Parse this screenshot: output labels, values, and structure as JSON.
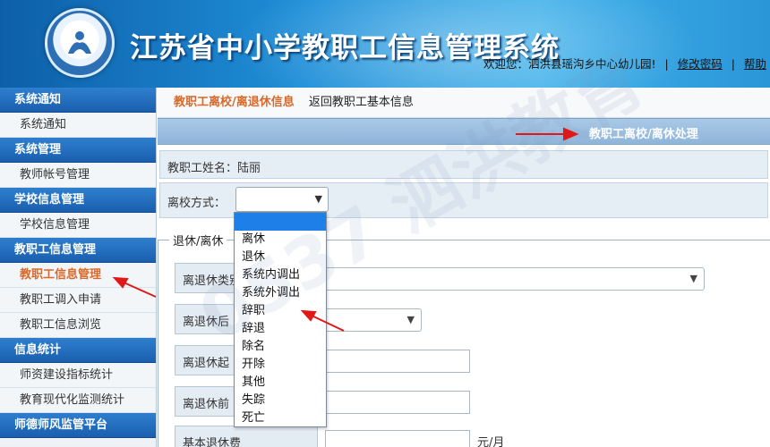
{
  "header": {
    "title": "江苏省中小学教职工信息管理系统",
    "welcome": "欢迎您：泗洪县瑶沟乡中心幼儿园!",
    "change_password": "修改密码",
    "help": "帮助"
  },
  "sidebar": {
    "sections": [
      {
        "title": "系统通知",
        "items": [
          "系统通知"
        ]
      },
      {
        "title": "系统管理",
        "items": [
          "教师帐号管理"
        ]
      },
      {
        "title": "学校信息管理",
        "items": [
          "学校信息管理"
        ]
      },
      {
        "title": "教职工信息管理",
        "items": [
          "教职工信息管理",
          "教职工调入申请",
          "教职工信息浏览"
        ]
      },
      {
        "title": "信息统计",
        "items": [
          "师资建设指标统计",
          "教育现代化监测统计"
        ]
      },
      {
        "title": "师德师风监管平台",
        "items": []
      }
    ],
    "active_item": "教职工信息管理"
  },
  "breadcrumb": {
    "current": "教职工离校/离退休信息",
    "back": "返回教职工基本信息"
  },
  "panel_title": "教职工离校/离休处理",
  "form": {
    "name_label": "教职工姓名：陆丽",
    "leave_mode_label": "离校方式：",
    "leave_mode_value": "",
    "leave_mode_options": [
      "",
      "离休",
      "退休",
      "系统内调出",
      "系统外调出",
      "辞职",
      "辞退",
      "除名",
      "开除",
      "其他",
      "失踪",
      "死亡"
    ],
    "section_legend": "退休/离休",
    "fields": [
      {
        "label": "离退休类别",
        "value": ""
      },
      {
        "label": "离退休后",
        "value": ""
      },
      {
        "label": "离退休起",
        "value": ""
      },
      {
        "label": "离退休前",
        "value": ""
      },
      {
        "label": "基本退休费",
        "value": "",
        "unit": "元/月"
      }
    ]
  },
  "watermark": "0537 泗洪教育"
}
